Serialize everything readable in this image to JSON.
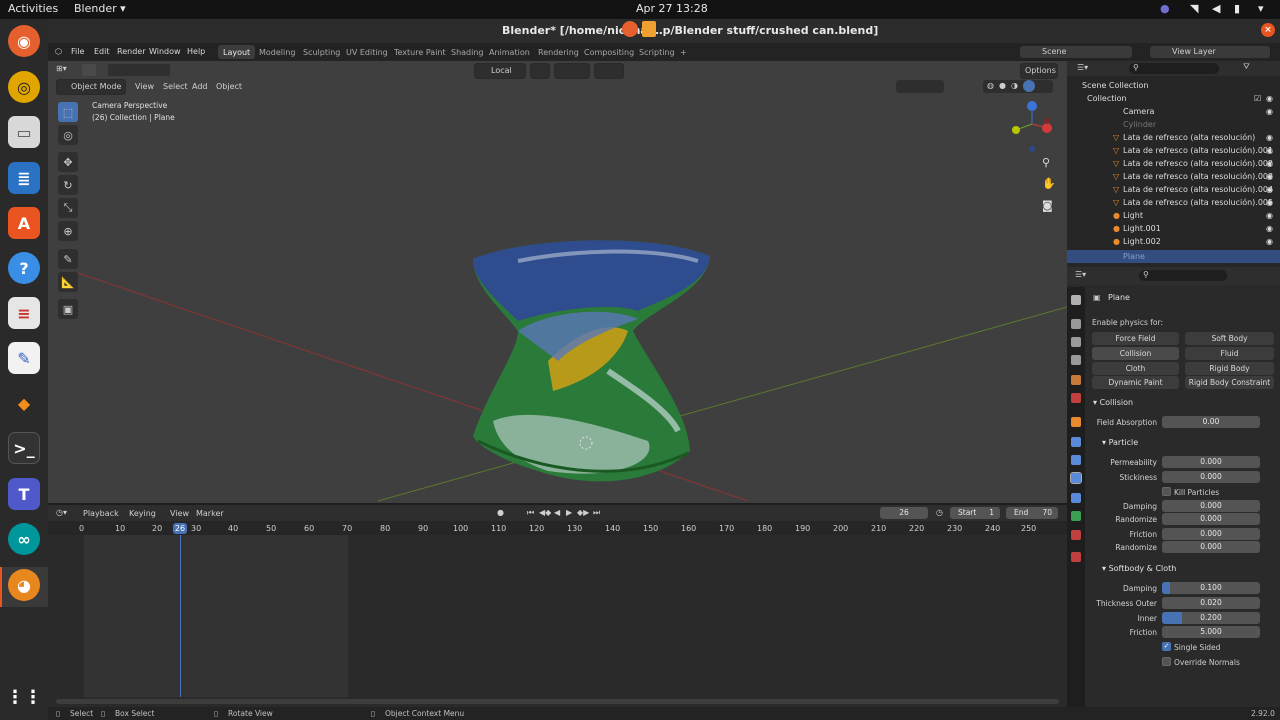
{
  "gnome": {
    "activities": "Activities",
    "app": "Blender ▾",
    "clock": "Apr 27  13:28"
  },
  "title": "Blender* [/home/nicknai…p/Blender stuff/crushed can.blend]",
  "menu": [
    "File",
    "Edit",
    "Render",
    "Window",
    "Help"
  ],
  "workspaces": [
    "Layout",
    "Modeling",
    "Sculpting",
    "UV Editing",
    "Texture Paint",
    "Shading",
    "Animation",
    "Rendering",
    "Compositing",
    "Scripting"
  ],
  "workspace_add": "+",
  "scene_field": "Scene",
  "viewlayer_field": "View Layer",
  "viewport": {
    "mode": "Object Mode",
    "menus": [
      "View",
      "Select",
      "Add",
      "Object"
    ],
    "orientation": "Local",
    "options": "Options",
    "info_line1": "Camera Perspective",
    "info_line2": "(26) Collection | Plane"
  },
  "outliner": {
    "root": "Scene Collection",
    "collection": "Collection",
    "items": [
      "Camera",
      "Cylinder",
      "Lata de refresco (alta resolución)",
      "Lata de refresco (alta resolución).001",
      "Lata de refresco (alta resolución).002",
      "Lata de refresco (alta resolución).003",
      "Lata de refresco (alta resolución).004",
      "Lata de refresco (alta resolución).005",
      "Light",
      "Light.001",
      "Light.002",
      "Plane"
    ]
  },
  "properties": {
    "object": "Plane",
    "enable_physics": "Enable physics for:",
    "physics_buttons": [
      "Force Field",
      "Soft Body",
      "Collision",
      "Fluid",
      "Cloth",
      "Rigid Body",
      "Dynamic Paint",
      "Rigid Body Constraint"
    ],
    "collision_header": "Collision",
    "field_absorption_label": "Field Absorption",
    "field_absorption": "0.00",
    "particle_header": "Particle",
    "permeability_label": "Permeability",
    "permeability": "0.000",
    "stickiness_label": "Stickiness",
    "stickiness": "0.000",
    "kill_particles": "Kill Particles",
    "damping_label": "Damping",
    "damping": "0.000",
    "randomize_label": "Randomize",
    "randomize": "0.000",
    "friction_label": "Friction",
    "friction": "0.000",
    "randomize2": "0.000",
    "softbody_header": "Softbody & Cloth",
    "sb_damping": "0.100",
    "thickness_outer_label": "Thickness Outer",
    "thickness_outer": "0.020",
    "inner_label": "Inner",
    "inner": "0.200",
    "sb_friction": "5.000",
    "single_sided": "Single Sided",
    "override_normals": "Override Normals"
  },
  "timeline": {
    "menus": [
      "Playback",
      "Keying",
      "View",
      "Marker"
    ],
    "current_frame": "26",
    "start_label": "Start",
    "start": "1",
    "end_label": "End",
    "end": "70",
    "ruler": [
      "0",
      "10",
      "20",
      "26",
      "30",
      "40",
      "50",
      "60",
      "70",
      "80",
      "90",
      "100",
      "110",
      "120",
      "130",
      "140",
      "150",
      "160",
      "170",
      "180",
      "190",
      "200",
      "210",
      "220",
      "230",
      "240",
      "250"
    ]
  },
  "status": {
    "select": "Select",
    "box_select": "Box Select",
    "rotate": "Rotate View",
    "context": "Object Context Menu",
    "version": "2.92.0"
  }
}
